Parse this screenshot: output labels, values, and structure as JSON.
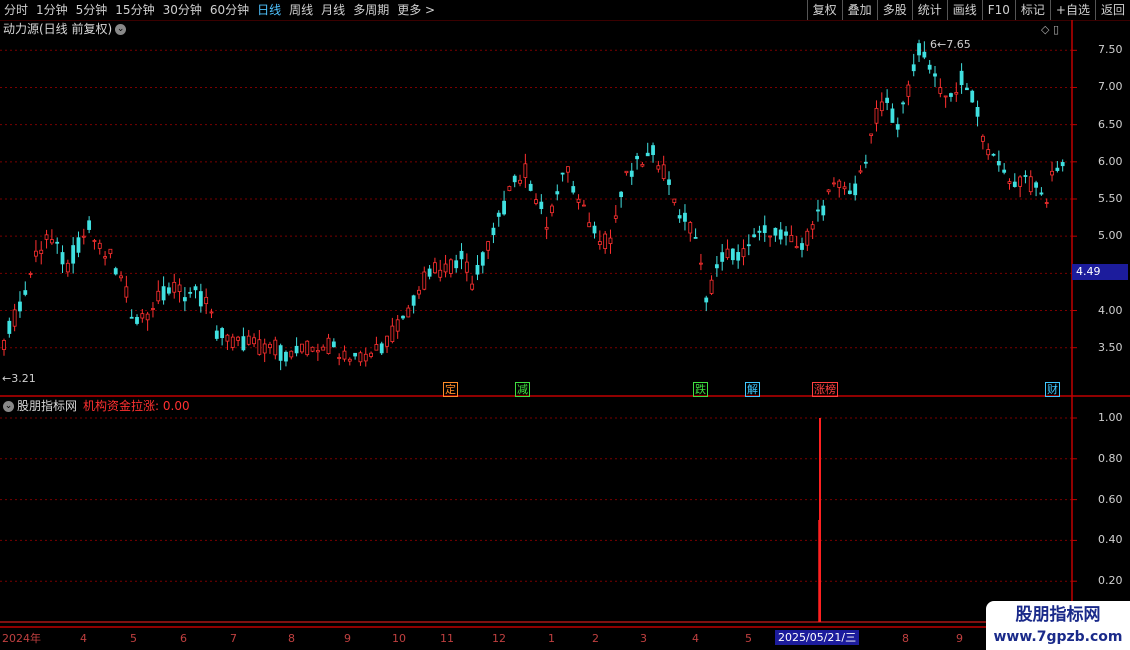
{
  "toolbar": {
    "periods": [
      "分时",
      "1分钟",
      "5分钟",
      "15分钟",
      "30分钟",
      "60分钟",
      "日线",
      "周线",
      "月线",
      "多周期",
      "更多 >"
    ],
    "active_period": "日线",
    "tools": [
      "复权",
      "叠加",
      "多股",
      "统计",
      "画线",
      "F10",
      "标记",
      "+自选",
      "返回"
    ]
  },
  "main": {
    "title": "动力源(日线 前复权)",
    "current_price": "4.49",
    "max_label": "7.65",
    "min_label": "3.21",
    "y_ticks": [
      "7.50",
      "7.00",
      "6.50",
      "6.00",
      "5.50",
      "5.00",
      "4.50",
      "4.00",
      "3.50"
    ],
    "events": [
      {
        "label": "定",
        "color": "#ff8c28"
      },
      {
        "label": "减",
        "color": "#40e040"
      },
      {
        "label": "跌",
        "color": "#40e040"
      },
      {
        "label": "解",
        "color": "#40c8ff"
      },
      {
        "label": "涨榜",
        "color": "#ff4040"
      },
      {
        "label": "财",
        "color": "#40c8ff"
      }
    ]
  },
  "indicator": {
    "name": "股朋指标网",
    "line_label": "机构资金拉涨: 0.00",
    "y_ticks": [
      "1.00",
      "0.80",
      "0.60",
      "0.40",
      "0.20"
    ],
    "signal_value": 1.0
  },
  "time_axis": {
    "months": [
      "2024年",
      "4",
      "5",
      "6",
      "7",
      "8",
      "9",
      "10",
      "11",
      "12",
      "1",
      "2",
      "3",
      "4",
      "5",
      "8",
      "9"
    ],
    "selected_date": "2025/05/21/三"
  },
  "watermark": {
    "line1": "股朋指标网",
    "line2": "www.7gpzb.com"
  },
  "colors": {
    "up": "#ff3030",
    "down": "#40e0e0",
    "grid": "#7a0000",
    "axis": "#c00000"
  },
  "chart_data": {
    "type": "candlestick",
    "title": "动力源(日线 前复权)",
    "ylim": [
      3.2,
      7.8
    ],
    "close_series": [
      3.6,
      3.9,
      4.3,
      4.7,
      5.0,
      4.8,
      4.6,
      4.9,
      5.1,
      4.8,
      4.7,
      4.4,
      4.0,
      3.9,
      4.1,
      4.2,
      4.3,
      4.25,
      4.2,
      4.1,
      3.7,
      3.6,
      3.55,
      3.6,
      3.5,
      3.55,
      3.45,
      3.4,
      3.45,
      3.5,
      3.55,
      3.5,
      3.45,
      3.4,
      3.35,
      3.5,
      3.6,
      3.8,
      4.0,
      4.3,
      4.5,
      4.55,
      4.6,
      4.8,
      4.3,
      4.7,
      5.1,
      5.4,
      5.7,
      5.9,
      5.5,
      5.2,
      5.6,
      5.9,
      5.4,
      5.2,
      5.0,
      4.9,
      5.6,
      5.9,
      6.0,
      6.1,
      5.9,
      5.5,
      5.2,
      5.0,
      4.1,
      4.6,
      4.8,
      4.7,
      4.9,
      5.0,
      5.1,
      5.0,
      4.9,
      4.8,
      5.2,
      5.4,
      5.6,
      5.7,
      5.6,
      6.1,
      6.6,
      6.8,
      6.5,
      7.0,
      7.5,
      7.3,
      7.0,
      6.8,
      7.1,
      6.9,
      6.4,
      6.0,
      5.9,
      5.7,
      5.8,
      5.6,
      5.5,
      6.0
    ],
    "indicator_spike": {
      "date": "2025/05/21",
      "value": 1.0
    }
  }
}
